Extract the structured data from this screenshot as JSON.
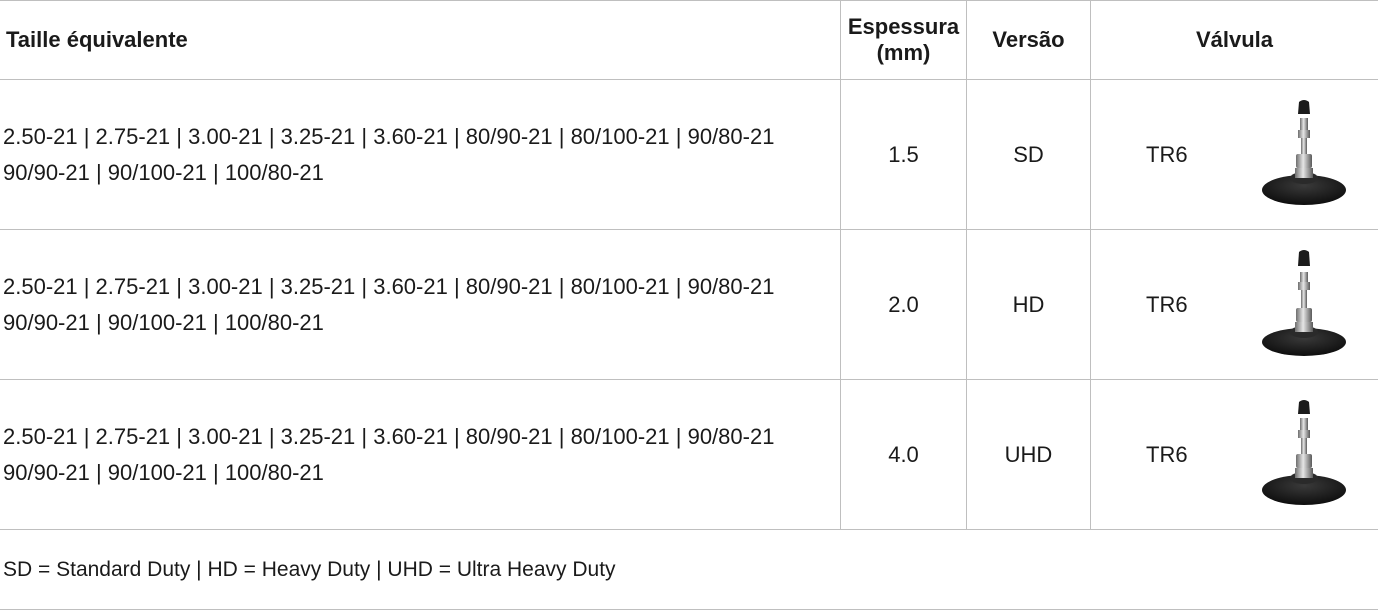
{
  "header": {
    "size_col": "Taille équivalente",
    "thickness_col_line1": "Espessura",
    "thickness_col_line2": "(mm)",
    "version_col": "Versão",
    "valve_col": "Válvula"
  },
  "rows": [
    {
      "sizes_line1": "2.50-21 | 2.75-21 | 3.00-21 | 3.25-21 | 3.60-21 | 80/90-21 | 80/100-21 | 90/80-21",
      "sizes_line2": "90/90-21 | 90/100-21 | 100/80-21",
      "thickness": "1.5",
      "version": "SD",
      "valve": "TR6",
      "valve_icon": "tr6-valve-icon"
    },
    {
      "sizes_line1": "2.50-21 | 2.75-21 | 3.00-21 | 3.25-21 | 3.60-21 | 80/90-21 | 80/100-21 | 90/80-21",
      "sizes_line2": "90/90-21 | 90/100-21 | 100/80-21",
      "thickness": "2.0",
      "version": "HD",
      "valve": "TR6",
      "valve_icon": "tr6-valve-icon"
    },
    {
      "sizes_line1": "2.50-21 | 2.75-21 | 3.00-21 | 3.25-21 | 3.60-21 | 80/90-21 | 80/100-21 | 90/80-21",
      "sizes_line2": "90/90-21 | 90/100-21 | 100/80-21",
      "thickness": "4.0",
      "version": "UHD",
      "valve": "TR6",
      "valve_icon": "tr6-valve-icon"
    }
  ],
  "legend": "SD = Standard Duty | HD = Heavy Duty | UHD = Ultra Heavy Duty",
  "colors": {
    "rule": "#bfbfbf",
    "text": "#1a1a1a"
  }
}
